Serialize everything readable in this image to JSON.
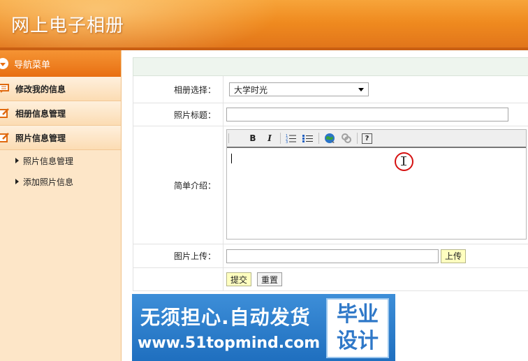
{
  "app": {
    "title": "网上电子相册"
  },
  "sidebar": {
    "header": "导航菜单",
    "items": [
      {
        "label": "修改我的信息",
        "icon": "note-icon"
      },
      {
        "label": "相册信息管理",
        "icon": "edit-icon"
      },
      {
        "label": "照片信息管理",
        "icon": "edit-icon"
      }
    ],
    "subitems": [
      {
        "label": "照片信息管理"
      },
      {
        "label": "添加照片信息"
      }
    ]
  },
  "form": {
    "album_label": "相册选择：",
    "album_value": "大学时光",
    "title_label": "照片标题：",
    "title_value": "",
    "intro_label": "简单介绍：",
    "upload_label": "图片上传：",
    "upload_value": "",
    "upload_button": "上传",
    "submit_button": "提交",
    "reset_button": "重置"
  },
  "editor": {
    "toolbar": {
      "bold": "B",
      "italic": "I",
      "ordered_list": "ordered-list-icon",
      "unordered_list": "unordered-list-icon",
      "link": "globe-link-icon",
      "unlink": "unlink-icon",
      "help": "?"
    },
    "content": ""
  },
  "banner": {
    "line1": "无须担心.自动发货",
    "line2": "www.51topmind.com",
    "box_line1": "毕业",
    "box_line2": "设计"
  },
  "colors": {
    "header_orange": "#ef8a1f",
    "sidebar_bg": "#fde6c8",
    "accent_red": "#d51010",
    "banner_blue": "#1f6fbf"
  }
}
